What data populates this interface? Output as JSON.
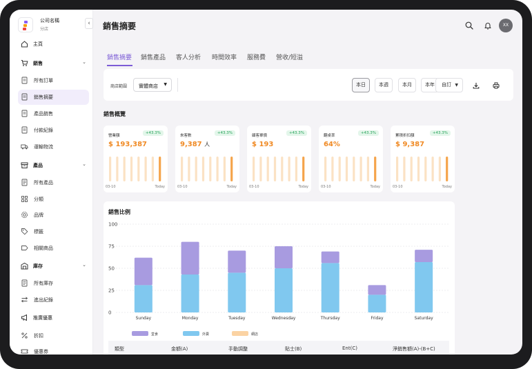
{
  "company": {
    "name": "公司名稱",
    "branch": "分店"
  },
  "sidebar": {
    "items": [
      {
        "label": "主頁",
        "kind": "top",
        "icon": "home-icon"
      },
      {
        "label": "銷售",
        "kind": "group",
        "icon": "cart-icon"
      },
      {
        "label": "所有訂單",
        "kind": "sub",
        "icon": "receipt-icon"
      },
      {
        "label": "銷售摘要",
        "kind": "sub",
        "icon": "receipt-icon",
        "active": true
      },
      {
        "label": "產品銷售",
        "kind": "sub",
        "icon": "receipt-icon"
      },
      {
        "label": "付款紀錄",
        "kind": "sub",
        "icon": "receipt-icon"
      },
      {
        "label": "運輸物流",
        "kind": "sub",
        "icon": "truck-icon"
      },
      {
        "label": "產品",
        "kind": "group",
        "icon": "box-icon"
      },
      {
        "label": "所有產品",
        "kind": "sub",
        "icon": "list-icon"
      },
      {
        "label": "分類",
        "kind": "sub",
        "icon": "grid-icon"
      },
      {
        "label": "品牌",
        "kind": "sub",
        "icon": "badge-icon"
      },
      {
        "label": "標籤",
        "kind": "sub",
        "icon": "tag-icon"
      },
      {
        "label": "相關商品",
        "kind": "sub",
        "icon": "label-icon"
      },
      {
        "label": "庫存",
        "kind": "group",
        "icon": "warehouse-icon"
      },
      {
        "label": "所有庫存",
        "kind": "sub",
        "icon": "list-icon"
      },
      {
        "label": "進出紀錄",
        "kind": "sub",
        "icon": "swap-icon"
      },
      {
        "label": "推廣優惠",
        "kind": "top",
        "icon": "megaphone-icon"
      },
      {
        "label": "折扣",
        "kind": "sub",
        "icon": "percent-icon"
      },
      {
        "label": "優惠券",
        "kind": "sub",
        "icon": "ticket-icon"
      }
    ]
  },
  "header": {
    "title": "銷售摘要",
    "avatar_initials": "XX"
  },
  "tabs": [
    "銷售摘要",
    "銷售產品",
    "客人分析",
    "時間效率",
    "服務費",
    "營收/短溢"
  ],
  "toolbar": {
    "range_label": "商店範圍",
    "store_value": "實體商店",
    "periods": [
      "本日",
      "本週",
      "本月",
      "本年"
    ],
    "custom_label": "自訂"
  },
  "overview": {
    "title": "銷售概覽",
    "cards": [
      {
        "name": "營業額",
        "pct": "+43.3%",
        "value": "$ 193,387",
        "unit": ""
      },
      {
        "name": "來客數",
        "pct": "+43.3%",
        "value": "9,387",
        "unit": "人"
      },
      {
        "name": "顧客單價",
        "pct": "+43.3%",
        "value": "$ 193",
        "unit": ""
      },
      {
        "name": "翻桌率",
        "pct": "+43.3%",
        "value": "64%",
        "unit": ""
      },
      {
        "name": "累積折扣額",
        "pct": "+43.3%",
        "value": "$ 9,387",
        "unit": ""
      }
    ],
    "date_start": "03-10",
    "date_end": "Today"
  },
  "colors": {
    "accent": "#7c5cd6",
    "orange": "#f08a24",
    "dine_in": "#a89be0",
    "takeout": "#80c8ef",
    "online": "#fbd3a3"
  },
  "chart_data": {
    "type": "bar",
    "stacked": true,
    "title": "銷售比例",
    "categories": [
      "Sunday",
      "Monday",
      "Tuesday",
      "Wednesday",
      "Thursday",
      "Friday",
      "Saturday"
    ],
    "series": [
      {
        "name": "外賣",
        "values": [
          31,
          43,
          45,
          50,
          56,
          20,
          57
        ]
      },
      {
        "name": "堂食",
        "values": [
          31,
          37,
          25,
          25,
          13,
          11,
          14
        ]
      },
      {
        "name": "網店",
        "values": [
          0,
          0,
          0,
          0,
          0,
          0,
          0
        ]
      }
    ],
    "ylim": [
      0,
      100
    ],
    "yticks": [
      0,
      25,
      50,
      75,
      100
    ],
    "grid": true,
    "legend": "bottom"
  },
  "table": {
    "headers": [
      "類型",
      "金額(A)",
      "手動調整",
      "貼士(B)",
      "Ent(C)",
      "淨銷售額(A)-(B+C)"
    ]
  }
}
